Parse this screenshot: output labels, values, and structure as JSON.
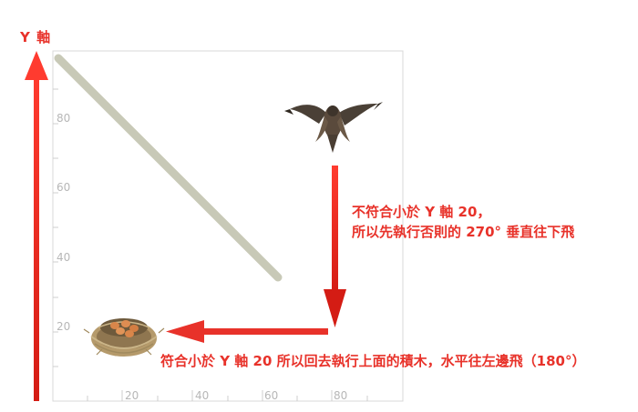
{
  "y_axis_title": "Y 軸",
  "x_ticks": [
    "20",
    "40",
    "60",
    "80"
  ],
  "y_ticks": [
    "80",
    "60",
    "40",
    "20"
  ],
  "notes": {
    "line1": "不符合小於 Y 軸 20，",
    "line2": "所以先執行否則的 270° 垂直往下飛",
    "line3": "符合小於 Y 軸 20 所以回去執行上面的積木，水平往左邊飛（180°）"
  },
  "colors": {
    "arrow": "#e8322a",
    "diagonal_path": "#c9cab8",
    "axis": "#cfcfcf",
    "tick_text": "#b7b7b7"
  },
  "icons": {
    "bird": "bird-icon",
    "nest": "nest-icon"
  }
}
